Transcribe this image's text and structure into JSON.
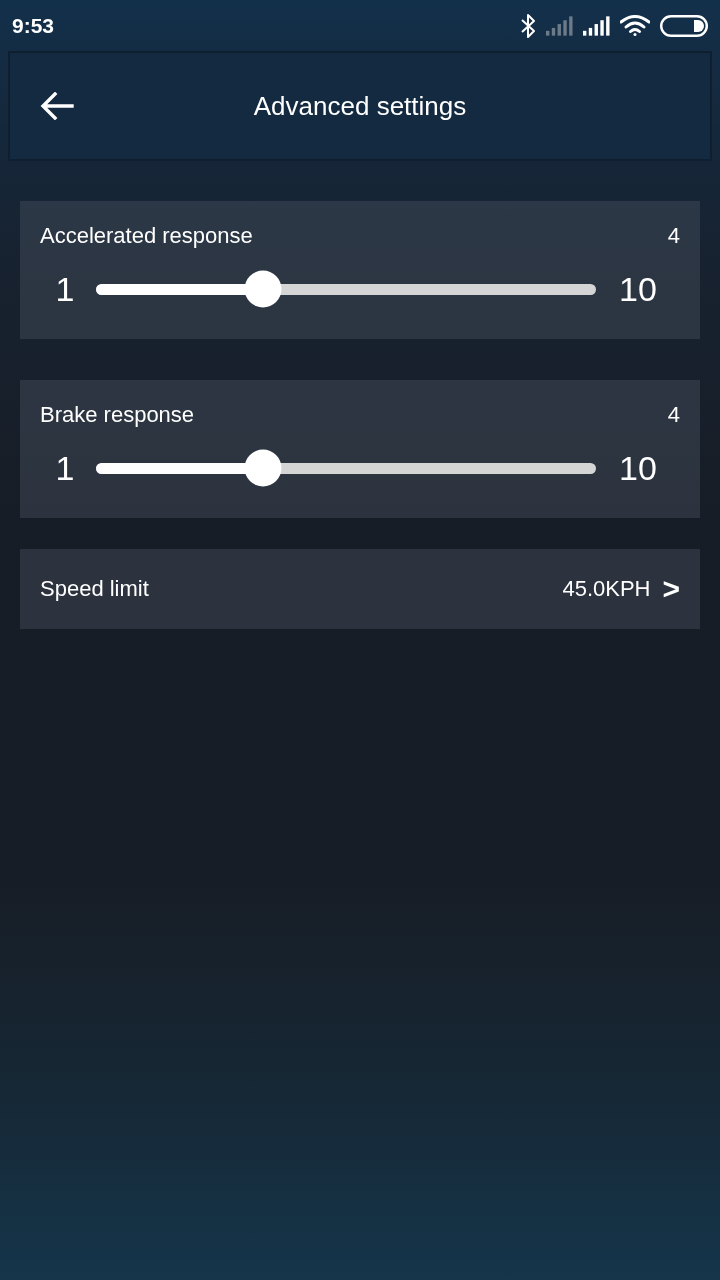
{
  "status_bar": {
    "time": "9:53"
  },
  "header": {
    "title": "Advanced settings"
  },
  "settings": [
    {
      "kind": "slider",
      "label": "Accelerated response",
      "value": "4",
      "min": "1",
      "max": "10",
      "level": 0.333
    },
    {
      "kind": "slider",
      "label": "Brake response",
      "value": "4",
      "min": "1",
      "max": "10",
      "level": 0.333
    },
    {
      "kind": "link",
      "label": "Speed limit",
      "value": "45.0KPH",
      "chevron": ">"
    }
  ]
}
